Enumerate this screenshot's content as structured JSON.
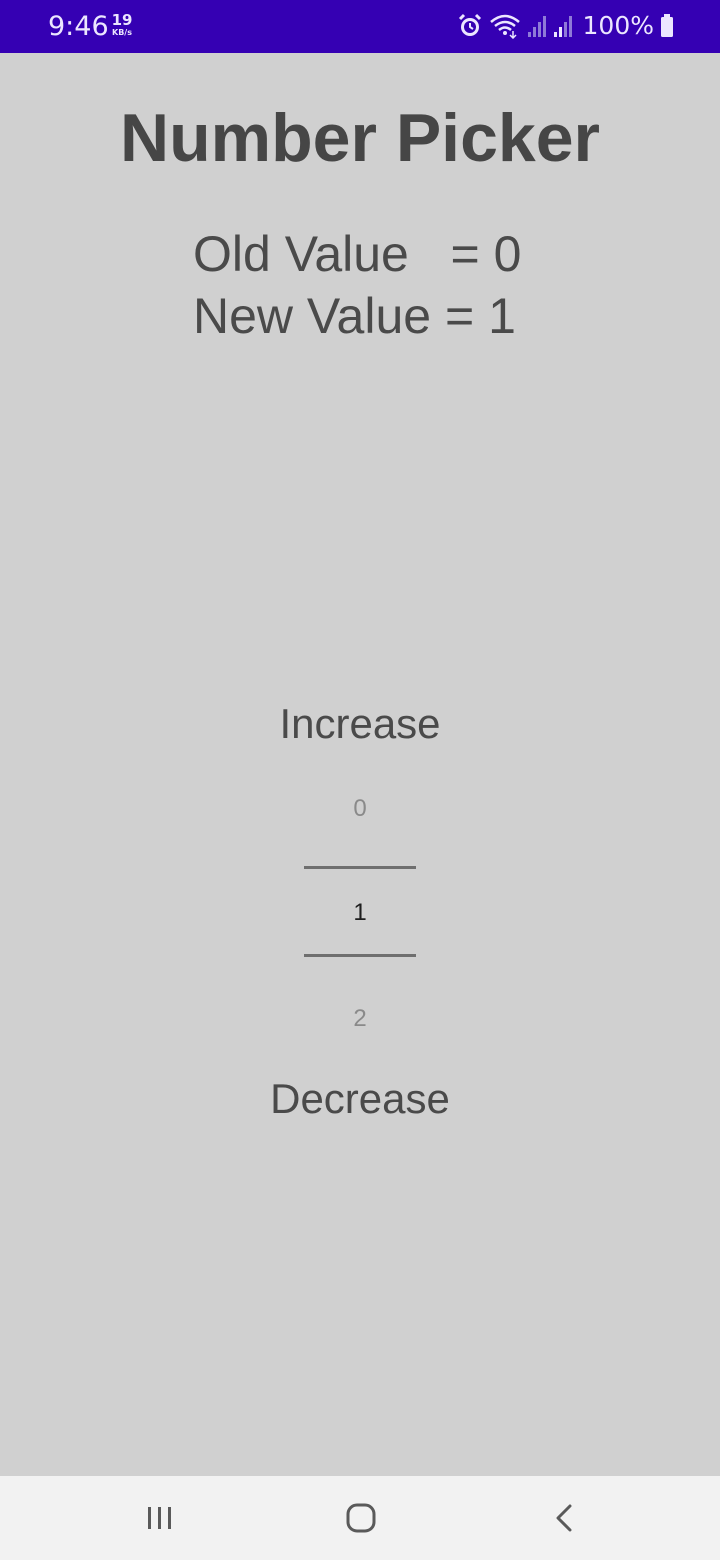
{
  "status_bar": {
    "time": "9:46",
    "netspeed_value": "19",
    "netspeed_unit": "KB/s",
    "battery_percent": "100%",
    "icons": [
      "alarm-icon",
      "wifi-icon",
      "signal-icon",
      "signal-icon-2",
      "battery-icon"
    ],
    "background_color": "#3500b3"
  },
  "app": {
    "title": "Number Picker",
    "old_value_text": "Old Value   = 0",
    "new_value_text": "New Value = 1",
    "background_color": "#d0d0d0"
  },
  "picker": {
    "increase_label": "Increase",
    "decrease_label": "Decrease",
    "previous_value": "0",
    "current_value": "1",
    "next_value": "2"
  },
  "nav_bar": {
    "buttons": [
      "recents-icon",
      "home-icon",
      "back-icon"
    ]
  }
}
